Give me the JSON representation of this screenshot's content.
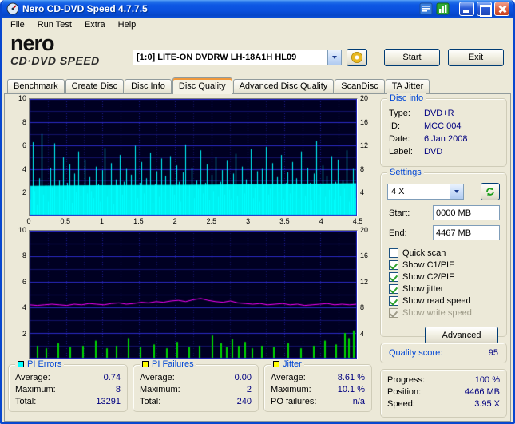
{
  "window": {
    "title": "Nero CD-DVD Speed 4.7.7.5"
  },
  "menu": [
    "File",
    "Run Test",
    "Extra",
    "Help"
  ],
  "logo": {
    "brand": "nero",
    "product": "CD·DVD SPEED"
  },
  "toolbar": {
    "drive": "[1:0]  LITE-ON DVDRW LH-18A1H HL09",
    "start_label": "Start",
    "exit_label": "Exit"
  },
  "tabs": [
    "Benchmark",
    "Create Disc",
    "Disc Info",
    "Disc Quality",
    "Advanced Disc Quality",
    "ScanDisc",
    "TA Jitter"
  ],
  "sidebar": {
    "disc_info": {
      "title": "Disc info",
      "rows": [
        {
          "label": "Type:",
          "value": "DVD+R"
        },
        {
          "label": "ID:",
          "value": "MCC 004"
        },
        {
          "label": "Date:",
          "value": "6 Jan 2008"
        },
        {
          "label": "Label:",
          "value": "DVD"
        }
      ]
    },
    "settings": {
      "title": "Settings",
      "speed_value": "4 X",
      "start_label": "Start:",
      "start_value": "0000 MB",
      "end_label": "End:",
      "end_value": "4467 MB",
      "checkboxes": [
        {
          "label": "Quick scan",
          "checked": false
        },
        {
          "label": "Show C1/PIE",
          "checked": true
        },
        {
          "label": "Show C2/PIF",
          "checked": true
        },
        {
          "label": "Show jitter",
          "checked": true
        },
        {
          "label": "Show read speed",
          "checked": true
        },
        {
          "label": "Show write speed",
          "checked": true,
          "disabled": true
        }
      ],
      "advanced_label": "Advanced"
    },
    "quality": {
      "label": "Quality score:",
      "value": "95"
    },
    "progress": {
      "rows": [
        {
          "label": "Progress:",
          "value": "100 %"
        },
        {
          "label": "Position:",
          "value": "4466 MB"
        },
        {
          "label": "Speed:",
          "value": "3.95 X"
        }
      ]
    }
  },
  "stats": {
    "pi_errors": {
      "title": "PI Errors",
      "swatch": "#00ffff",
      "rows": [
        [
          "Average:",
          "0.74"
        ],
        [
          "Maximum:",
          "8"
        ],
        [
          "Total:",
          "13291"
        ]
      ]
    },
    "pi_failures": {
      "title": "PI Failures",
      "swatch": "#ffff00",
      "rows": [
        [
          "Average:",
          "0.00"
        ],
        [
          "Maximum:",
          "2"
        ],
        [
          "Total:",
          "240"
        ]
      ]
    },
    "jitter": {
      "title": "Jitter",
      "swatch": "#ffff00",
      "rows": [
        [
          "Average:",
          "8.61 %"
        ],
        [
          "Maximum:",
          "10.1 %"
        ],
        [
          "PO failures:",
          "n/a"
        ]
      ]
    }
  },
  "chart_data": [
    {
      "type": "bar",
      "name": "PI Errors scan",
      "x_min": 0,
      "x_max": 4.5,
      "x_ticks": [
        "0",
        "0.5",
        "1",
        "1.5",
        "2",
        "2.5",
        "3",
        "3.5",
        "4",
        "4.5"
      ],
      "y_left": {
        "min": 0,
        "max": 10,
        "ticks": [
          "10",
          "8",
          "6",
          "4",
          "2"
        ]
      },
      "y_right": {
        "min": 0,
        "max": 20,
        "ticks": [
          "20",
          "16",
          "12",
          "8",
          "4"
        ]
      },
      "bg": "#000022",
      "grid": {
        "major": "#2b2bc8",
        "minor": "#13136a",
        "vertical": "#1d1d96"
      },
      "series": [
        {
          "name": "read speed",
          "type": "area",
          "axis": "left",
          "color": "#00efef",
          "values": [
            2.55,
            2.58,
            2.6,
            2.62,
            2.64,
            2.66,
            2.68,
            2.7,
            2.74,
            2.78
          ]
        },
        {
          "name": "PI errors",
          "type": "bars",
          "axis": "left",
          "color": "#00ffff",
          "values": [
            1.4,
            6.3,
            2.1,
            0.9,
            3.2,
            7.0,
            1.8,
            2.6,
            1.2,
            4.1,
            2.4,
            6.2,
            1.6,
            3.0,
            2.2,
            5.0,
            1.3,
            2.8,
            4.4,
            1.1,
            3.6,
            2.0,
            5.5,
            1.7,
            2.5,
            4.8,
            1.9,
            3.3,
            2.1,
            1.5,
            4.2,
            2.7,
            1.2,
            3.9,
            5.8,
            1.6,
            2.3,
            4.5,
            1.0,
            3.1,
            2.6,
            5.2,
            1.8,
            2.9,
            4.0,
            1.3,
            3.5,
            2.2,
            6.0,
            1.5,
            2.8,
            4.6,
            1.9,
            3.2,
            2.4,
            5.4,
            1.1,
            2.7,
            3.8,
            1.6,
            4.9,
            2.0,
            3.4,
            1.4,
            5.1,
            2.5,
            1.8,
            4.3,
            2.9,
            1.2,
            3.7,
            6.1,
            1.7,
            2.6,
            4.1,
            1.5,
            3.0,
            2.3,
            5.6,
            1.9,
            2.8,
            4.4,
            1.3,
            3.5,
            2.1,
            5.0,
            1.6,
            2.9,
            3.9,
            1.8,
            4.7,
            2.2,
            1.4,
            3.6,
            5.3,
            1.7,
            2.5,
            4.2,
            1.9,
            3.1,
            2.7,
            5.7,
            1.5,
            2.4,
            3.8,
            1.2,
            4.0,
            2.6,
            5.9,
            1.8,
            2.3,
            4.5,
            1.6,
            3.3,
            2.0,
            5.2,
            1.4,
            2.8,
            3.7,
            1.9,
            4.6,
            2.1,
            3.2,
            1.5,
            5.5,
            2.4,
            1.7,
            4.1,
            2.8,
            1.3,
            3.6,
            6.4,
            1.8,
            2.5,
            4.3,
            1.6,
            3.4,
            2.2,
            5.1,
            1.4,
            2.9,
            4.8,
            1.7,
            3.0,
            2.3,
            5.6,
            1.2,
            2.7,
            4.0,
            1.5
          ]
        }
      ]
    },
    {
      "type": "bar",
      "name": "PI Failures / Jitter scan",
      "x_min": 0,
      "x_max": 4.5,
      "x_ticks": [],
      "y_left": {
        "min": 0,
        "max": 10,
        "ticks": [
          "10",
          "8",
          "6",
          "4",
          "2"
        ]
      },
      "y_right": {
        "min": 0,
        "max": 20,
        "ticks": [
          "20",
          "16",
          "12",
          "8",
          "4"
        ]
      },
      "bg": "#000022",
      "grid": {
        "major": "#2b2bc8",
        "minor": "#13136a",
        "vertical": "#1d1d96"
      },
      "series": [
        {
          "name": "PI failures",
          "type": "sparse-bars",
          "axis": "left",
          "color": "#00d800",
          "points": [
            [
              0.1,
              1.0
            ],
            [
              0.22,
              0.8
            ],
            [
              0.38,
              1.2
            ],
            [
              0.55,
              0.9
            ],
            [
              0.72,
              1.0
            ],
            [
              0.9,
              1.4
            ],
            [
              1.05,
              0.8
            ],
            [
              1.18,
              1.0
            ],
            [
              1.35,
              1.6
            ],
            [
              1.52,
              0.9
            ],
            [
              1.7,
              1.1
            ],
            [
              1.88,
              0.8
            ],
            [
              2.02,
              1.3
            ],
            [
              2.18,
              0.9
            ],
            [
              2.33,
              1.0
            ],
            [
              2.5,
              1.8
            ],
            [
              2.62,
              1.2
            ],
            [
              2.7,
              0.9
            ],
            [
              2.78,
              1.5
            ],
            [
              2.86,
              1.0
            ],
            [
              2.95,
              1.3
            ],
            [
              3.05,
              0.8
            ],
            [
              3.18,
              1.0
            ],
            [
              3.35,
              0.9
            ],
            [
              3.55,
              1.2
            ],
            [
              3.72,
              0.8
            ],
            [
              3.9,
              1.0
            ],
            [
              4.05,
              1.4
            ],
            [
              4.2,
              1.1
            ],
            [
              4.32,
              2.0
            ],
            [
              4.38,
              1.6
            ],
            [
              4.44,
              2.2
            ]
          ]
        },
        {
          "name": "jitter",
          "type": "line",
          "axis": "right",
          "color": "#ff00ff",
          "values": [
            8.4,
            8.3,
            8.4,
            8.5,
            8.4,
            8.3,
            8.5,
            8.4,
            8.6,
            8.5,
            8.4,
            8.6,
            8.7,
            8.5,
            8.6,
            8.8,
            8.7,
            8.9,
            8.8,
            9.0,
            9.1,
            8.9,
            9.2,
            9.4,
            9.1,
            8.9,
            8.8,
            9.0,
            8.7,
            8.6,
            8.5,
            8.6,
            8.4,
            8.5,
            8.6,
            8.4,
            8.5,
            8.3,
            8.4,
            8.5,
            8.6,
            8.4,
            8.5,
            8.4,
            8.5
          ]
        }
      ]
    }
  ]
}
